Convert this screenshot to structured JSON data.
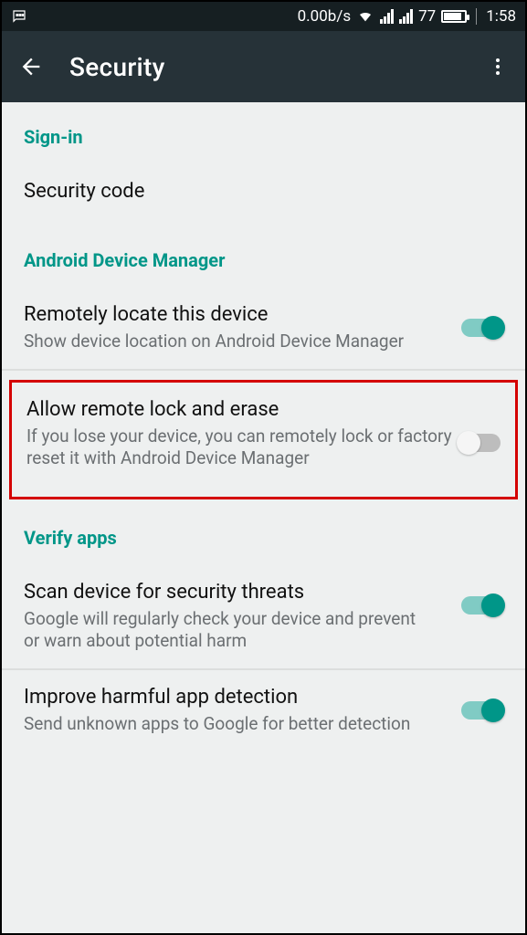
{
  "status": {
    "network_speed": "0.00b/s",
    "battery_pct": "77",
    "time": "1:58"
  },
  "header": {
    "title": "Security"
  },
  "sections": {
    "signin": {
      "header": "Sign-in",
      "security_code": "Security code"
    },
    "adm": {
      "header": "Android Device Manager",
      "locate": {
        "title": "Remotely locate this device",
        "subtitle": "Show device location on Android Device Manager",
        "enabled": true
      },
      "lock_erase": {
        "title": "Allow remote lock and erase",
        "subtitle": "If you lose your device, you can remotely lock or factory reset it with Android Device Manager",
        "enabled": false
      }
    },
    "verify": {
      "header": "Verify apps",
      "scan": {
        "title": "Scan device for security threats",
        "subtitle": "Google will regularly check your device and prevent or warn about potential harm",
        "enabled": true
      },
      "improve": {
        "title": "Improve harmful app detection",
        "subtitle": "Send unknown apps to Google for better detection",
        "enabled": true
      }
    }
  }
}
